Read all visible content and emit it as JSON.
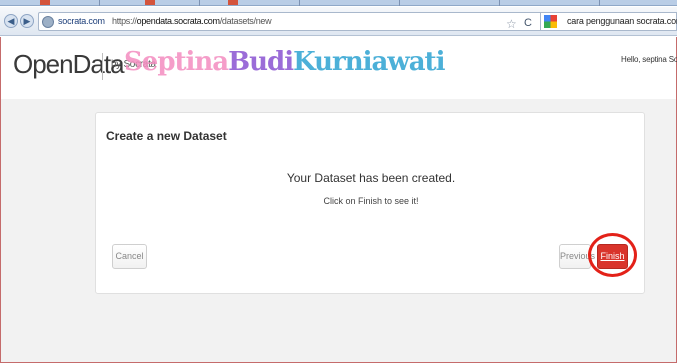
{
  "browser": {
    "site_identity": "socrata.com",
    "url_prefix": "https://",
    "url_host": "opendata.socrata.com",
    "url_path": "/datasets/new",
    "search_query": "cara penggunaan socrata.com",
    "back_glyph": "◀",
    "forward_glyph": "▶",
    "star_glyph": "☆",
    "reload_glyph": "C"
  },
  "header": {
    "logo": "OpenData",
    "by_label": "by Socrata",
    "watermark": {
      "part1": "Septina",
      "part2": "Budi",
      "part3": "Kurniawati"
    },
    "user_greeting": "Hello, septina   Socr"
  },
  "wizard": {
    "title": "Create a new Dataset",
    "message": "Your Dataset has been created.",
    "submessage": "Click on Finish to see it!",
    "cancel_label": "Cancel",
    "previous_label": "Previous",
    "finish_label": "Finish"
  },
  "colors": {
    "finish_button": "#d9342b",
    "annotation_circle": "#e32118"
  }
}
